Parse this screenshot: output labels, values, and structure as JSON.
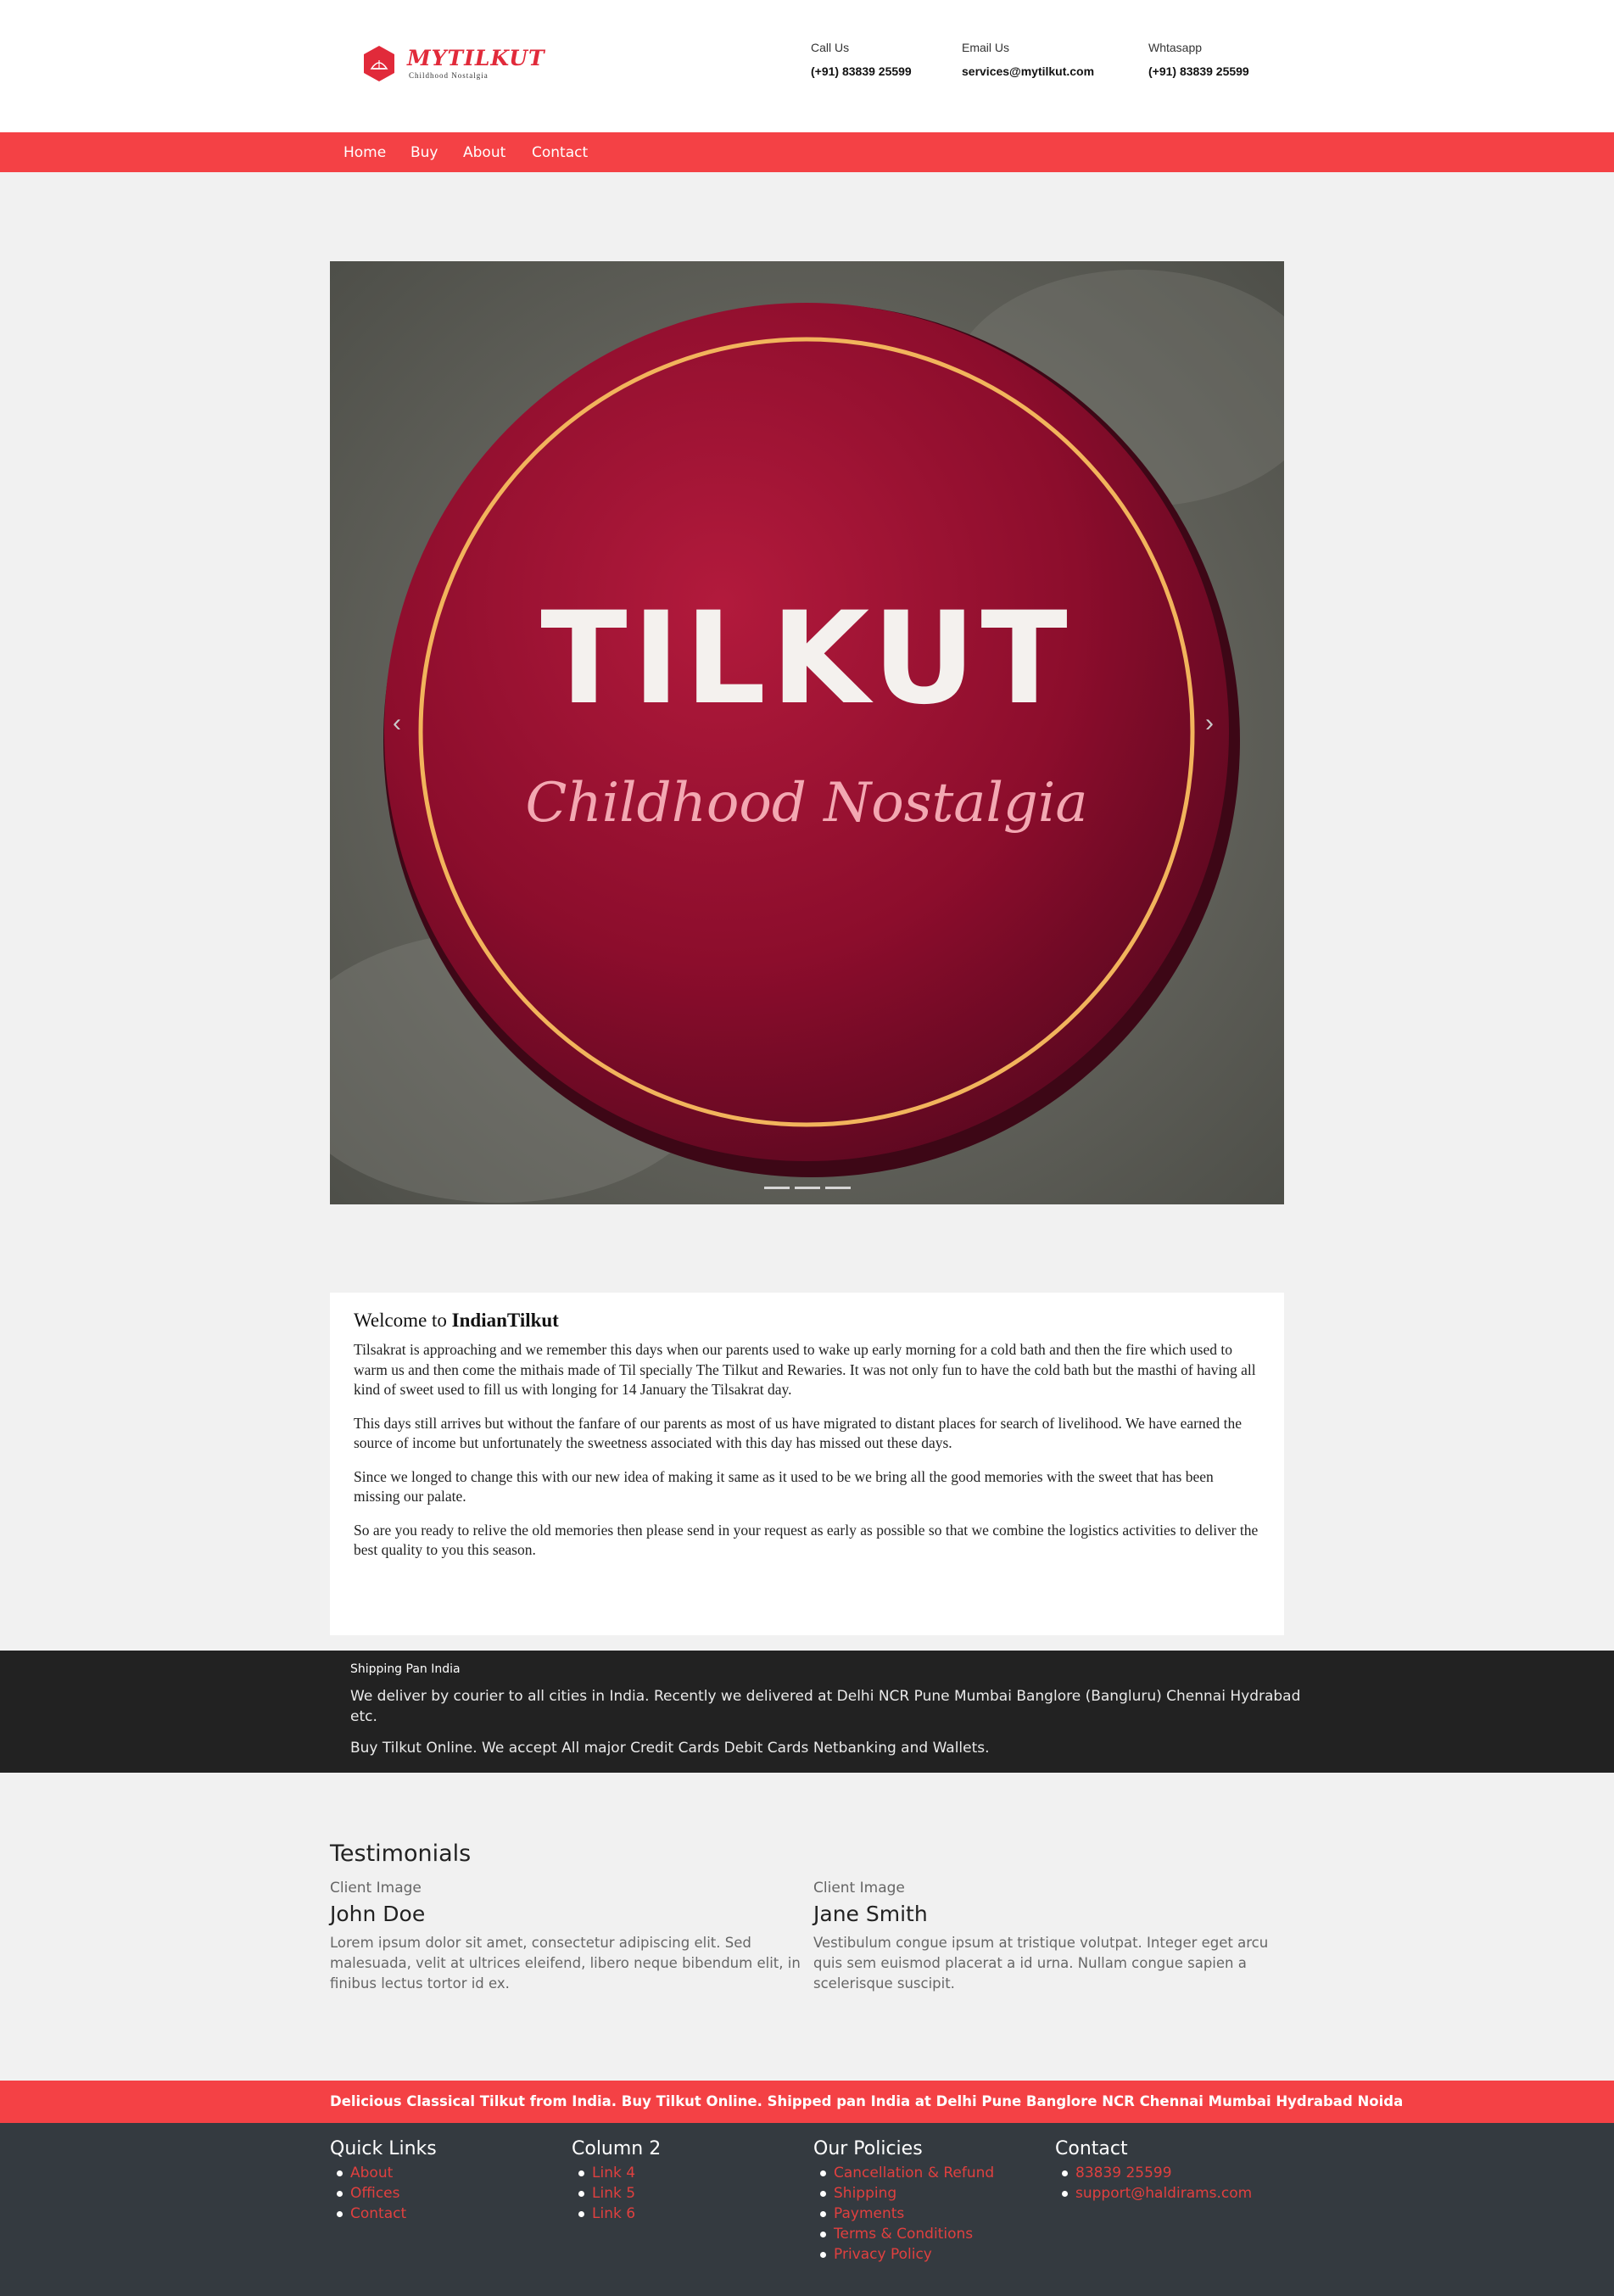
{
  "brand": {
    "name": "MYTILKUT",
    "tagline": "Childhood Nostalgia",
    "color": "#e12a3a"
  },
  "contacts": [
    {
      "label": "Call Us",
      "value": "(+91) 83839 25599"
    },
    {
      "label": "Email Us",
      "value": "services@mytilkut.com"
    },
    {
      "label": "Whtasapp",
      "value": "(+91) 83839 25599"
    }
  ],
  "nav": {
    "items": [
      "Home",
      "Buy",
      "About",
      "Contact"
    ],
    "color": "#f44145"
  },
  "carousel": {
    "image_text_main": "TILKUT",
    "image_text_sub": "Childhood Nostalgia",
    "prev_icon": "chevron-left-icon",
    "next_icon": "chevron-right-icon",
    "indicator_count": 3
  },
  "welcome": {
    "title_prefix": "Welcome to",
    "title_bold": "IndianTilkut",
    "paragraphs": [
      "Tilsakrat is approaching and we remember this days when our parents used to wake up early morning for a cold bath and then the fire which used to warm us and then come the mithais made of Til specially The Tilkut and Rewaries. It was not only fun to have the cold bath but the masthi of having all kind of sweet used to fill us with longing for 14 January the Tilsakrat day.",
      "This days still arrives but without the fanfare of our parents as most of us have migrated to distant places for search of livelihood. We have earned the source of income but unfortunately the sweetness associated with this day has missed out these days.",
      "Since we longed to change this with our new idea of making it same as it used to be we bring all the good memories with the sweet that has been missing our palate.",
      "So are you ready to relive the old memories then please send in your request as early as possible so that we combine the logistics activities to deliver the best quality to you this season."
    ]
  },
  "shipping": {
    "title": "Shipping Pan India",
    "text1": "We deliver by courier to all cities in India. Recently we delivered at Delhi NCR Pune Mumbai Banglore (Bangluru) Chennai Hydrabad etc.",
    "text2": "Buy Tilkut Online. We accept All major Credit Cards Debit Cards Netbanking and Wallets."
  },
  "testimonials": {
    "heading": "Testimonials",
    "items": [
      {
        "image": "Client Image",
        "name": "John Doe",
        "text": "Lorem ipsum dolor sit amet, consectetur adipiscing elit. Sed malesuada, velit at ultrices eleifend, libero neque bibendum elit, in finibus lectus tortor id ex."
      },
      {
        "image": "Client Image",
        "name": "Jane Smith",
        "text": "Vestibulum congue ipsum at tristique volutpat. Integer eget arcu quis sem euismod placerat a id urna. Nullam congue sapien a scelerisque suscipit."
      }
    ]
  },
  "banner": {
    "text": "Delicious Classical Tilkut from India. Buy Tilkut Online. Shipped pan India at Delhi Pune Banglore NCR Chennai Mumbai Hydrabad Noida"
  },
  "footer": {
    "columns": [
      {
        "title": "Quick Links",
        "links": [
          "About",
          "Offices",
          "Contact"
        ]
      },
      {
        "title": "Column 2",
        "links": [
          "Link 4",
          "Link 5",
          "Link 6"
        ]
      },
      {
        "title": "Our Policies",
        "links": [
          "Cancellation & Refund",
          "Shipping",
          "Payments",
          "Terms & Conditions",
          "Privacy Policy"
        ]
      },
      {
        "title": "Contact",
        "links": [
          "83839 25599",
          "support@haldirams.com"
        ]
      }
    ],
    "link_color": "#e0403f",
    "background": "#343a40"
  }
}
